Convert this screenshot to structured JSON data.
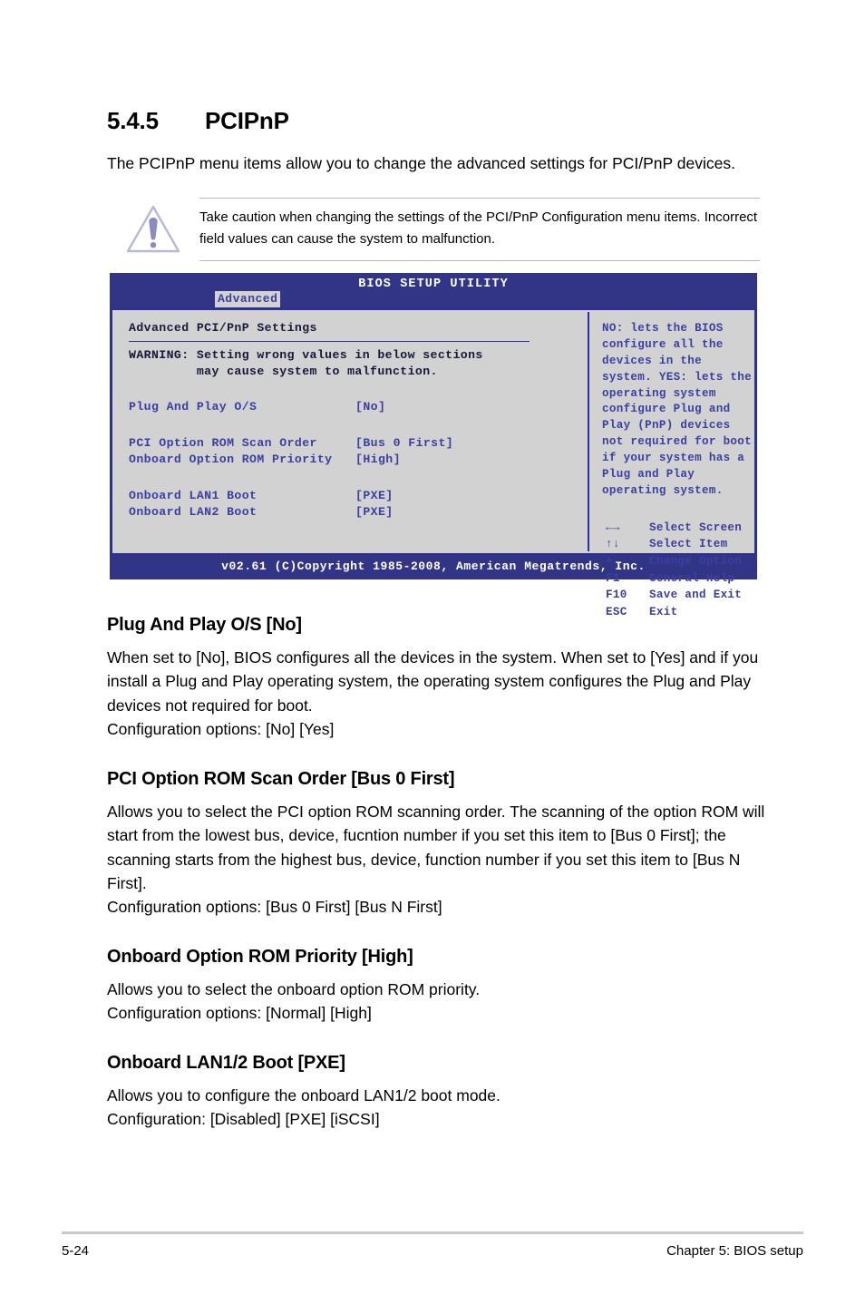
{
  "section": {
    "number": "5.4.5",
    "title": "PCIPnP",
    "intro": "The PCIPnP menu items allow you to change the advanced settings for PCI/PnP devices."
  },
  "caution": {
    "icon": "warning-triangle-icon",
    "text": "Take caution when changing the settings of the PCI/PnP Configuration menu items. Incorrect field values can cause the system to malfunction."
  },
  "bios": {
    "title": "BIOS SETUP UTILITY",
    "active_tab": "Advanced",
    "panel_heading": "Advanced PCI/PnP Settings",
    "warning_line1": "WARNING: Setting wrong values in below sections",
    "warning_line2": "         may cause system to malfunction.",
    "options": [
      {
        "label": "Plug And Play O/S",
        "value": "[No]"
      },
      {
        "label": "PCI Option ROM Scan Order",
        "value": "[Bus 0 First]"
      },
      {
        "label": "Onboard Option ROM Priority",
        "value": "[High]"
      },
      {
        "label": "Onboard LAN1 Boot",
        "value": "[PXE]"
      },
      {
        "label": "Onboard LAN2 Boot",
        "value": "[PXE]"
      }
    ],
    "help_text": "NO: lets the BIOS configure all the devices in the system. YES: lets the operating system configure Plug and Play (PnP) devices not required for boot if your system has a Plug and Play operating system.",
    "keys": [
      {
        "key": "←→",
        "desc": "Select Screen"
      },
      {
        "key": "↑↓",
        "desc": "Select Item"
      },
      {
        "key": "+-",
        "desc": "Change Option"
      },
      {
        "key": "F1",
        "desc": "General Help"
      },
      {
        "key": "F10",
        "desc": "Save and Exit"
      },
      {
        "key": "ESC",
        "desc": "Exit"
      }
    ],
    "footer": "v02.61 (C)Copyright 1985-2008, American Megatrends, Inc.",
    "colors": {
      "chrome_blue": "#2e3192",
      "panel_gray": "#d2d2d2",
      "text_blue": "#3b3fa0"
    }
  },
  "descriptions": [
    {
      "heading": "Plug And Play O/S [No]",
      "body": "When set to [No], BIOS configures all the devices in the system. When set to [Yes] and if you install a Plug and Play operating system, the operating system configures the Plug and Play devices not required for boot.\nConfiguration options: [No] [Yes]"
    },
    {
      "heading": "PCI Option ROM Scan Order [Bus 0 First]",
      "body": "Allows you to select the PCI option ROM scanning order. The scanning of the option ROM will start from the lowest bus, device, fucntion number if you set this item to [Bus 0 First]; the scanning starts from the highest bus, device, function number if you set this item to [Bus N First].\nConfiguration options: [Bus 0 First] [Bus N First]"
    },
    {
      "heading": "Onboard Option ROM Priority [High]",
      "body": "Allows you to select the onboard option ROM priority.\nConfiguration options: [Normal] [High]"
    },
    {
      "heading": "Onboard LAN1/2 Boot [PXE]",
      "body": "Allows you to configure the onboard LAN1/2 boot mode.\nConfiguration: [Disabled] [PXE] [iSCSI]"
    }
  ],
  "page_footer": {
    "page_number": "5-24",
    "chapter": "Chapter 5: BIOS setup"
  }
}
